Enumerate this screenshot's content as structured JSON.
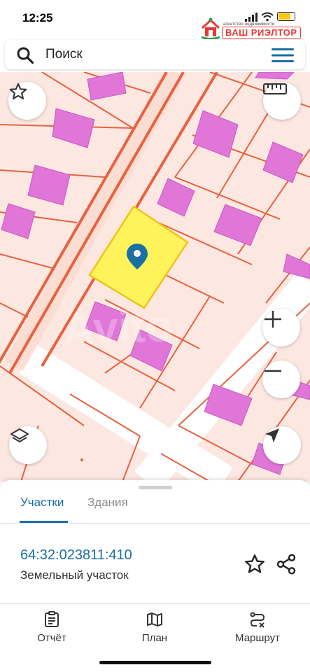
{
  "status_bar": {
    "time": "12:25"
  },
  "logo": {
    "agency": "агентство недвижимости",
    "brand": "ВАШ РИЭЛТОР"
  },
  "search": {
    "placeholder": "Поиск"
  },
  "colors": {
    "accent": "#1a6fa3",
    "parcel_line": "#e8623f",
    "building": "#e076d8",
    "selected_parcel": "#fff35c",
    "map_bg": "#fde7e1"
  },
  "map_controls": [
    {
      "icon": "star-outline-icon"
    },
    {
      "icon": "ruler-icon"
    },
    {
      "icon": "layers-icon"
    },
    {
      "icon": "zoom-in-icon"
    },
    {
      "icon": "zoom-out-icon"
    },
    {
      "icon": "locate-arrow-icon"
    }
  ],
  "sheet": {
    "tabs": [
      {
        "label": "Участки",
        "active": true
      },
      {
        "label": "Здания",
        "active": false
      }
    ],
    "parcel": {
      "number": "64:32:023811:410",
      "type": "Земельный участок"
    }
  },
  "bottom_nav": [
    {
      "label": "Отчёт",
      "icon": "report-icon"
    },
    {
      "label": "План",
      "icon": "map-plan-icon"
    },
    {
      "label": "Маршрут",
      "icon": "route-icon"
    }
  ]
}
